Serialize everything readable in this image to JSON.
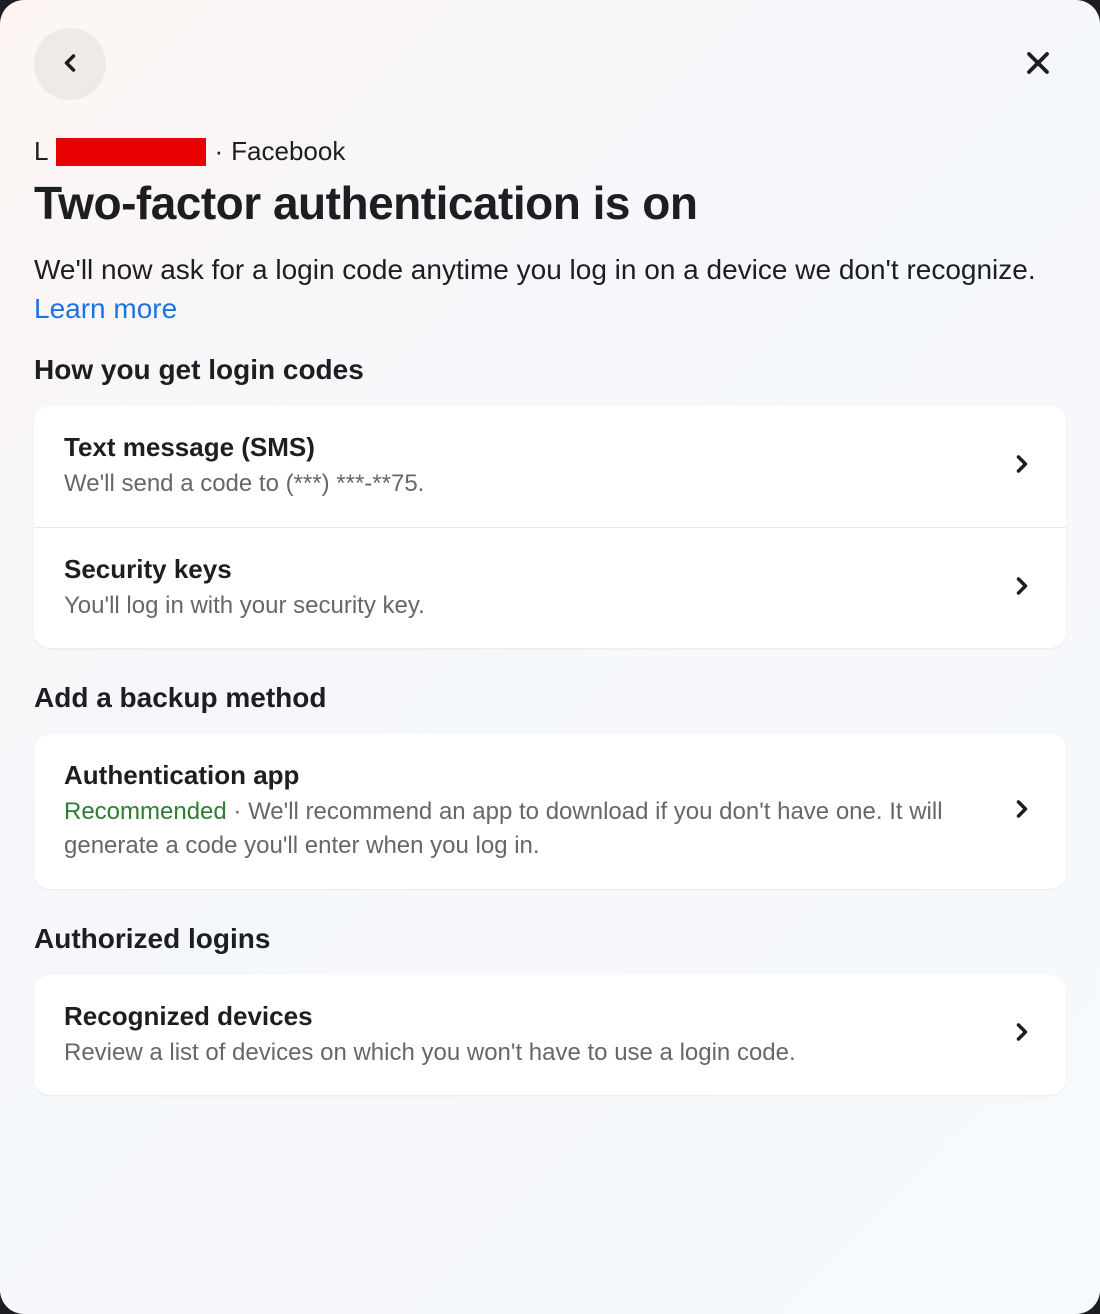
{
  "breadcrumb": {
    "name_initial": "L",
    "separator": "·",
    "platform": "Facebook"
  },
  "header": {
    "title": "Two-factor authentication is on",
    "description": "We'll now ask for a login code anytime you log in on a device we don't recognize. ",
    "learn_more": "Learn more"
  },
  "sections": {
    "login_codes": {
      "title": "How you get login codes",
      "items": [
        {
          "title": "Text message (SMS)",
          "subtitle": "We'll send a code to (***) ***-**75."
        },
        {
          "title": "Security keys",
          "subtitle": "You'll log in with your security key."
        }
      ]
    },
    "backup": {
      "title": "Add a backup method",
      "items": [
        {
          "title": "Authentication app",
          "recommended_label": "Recommended",
          "separator": " · ",
          "subtitle": "We'll recommend an app to download if you don't have one. It will generate a code you'll enter when you log in."
        }
      ]
    },
    "authorized": {
      "title": "Authorized logins",
      "items": [
        {
          "title": "Recognized devices",
          "subtitle": "Review a list of devices on which you won't have to use a login code."
        }
      ]
    }
  }
}
